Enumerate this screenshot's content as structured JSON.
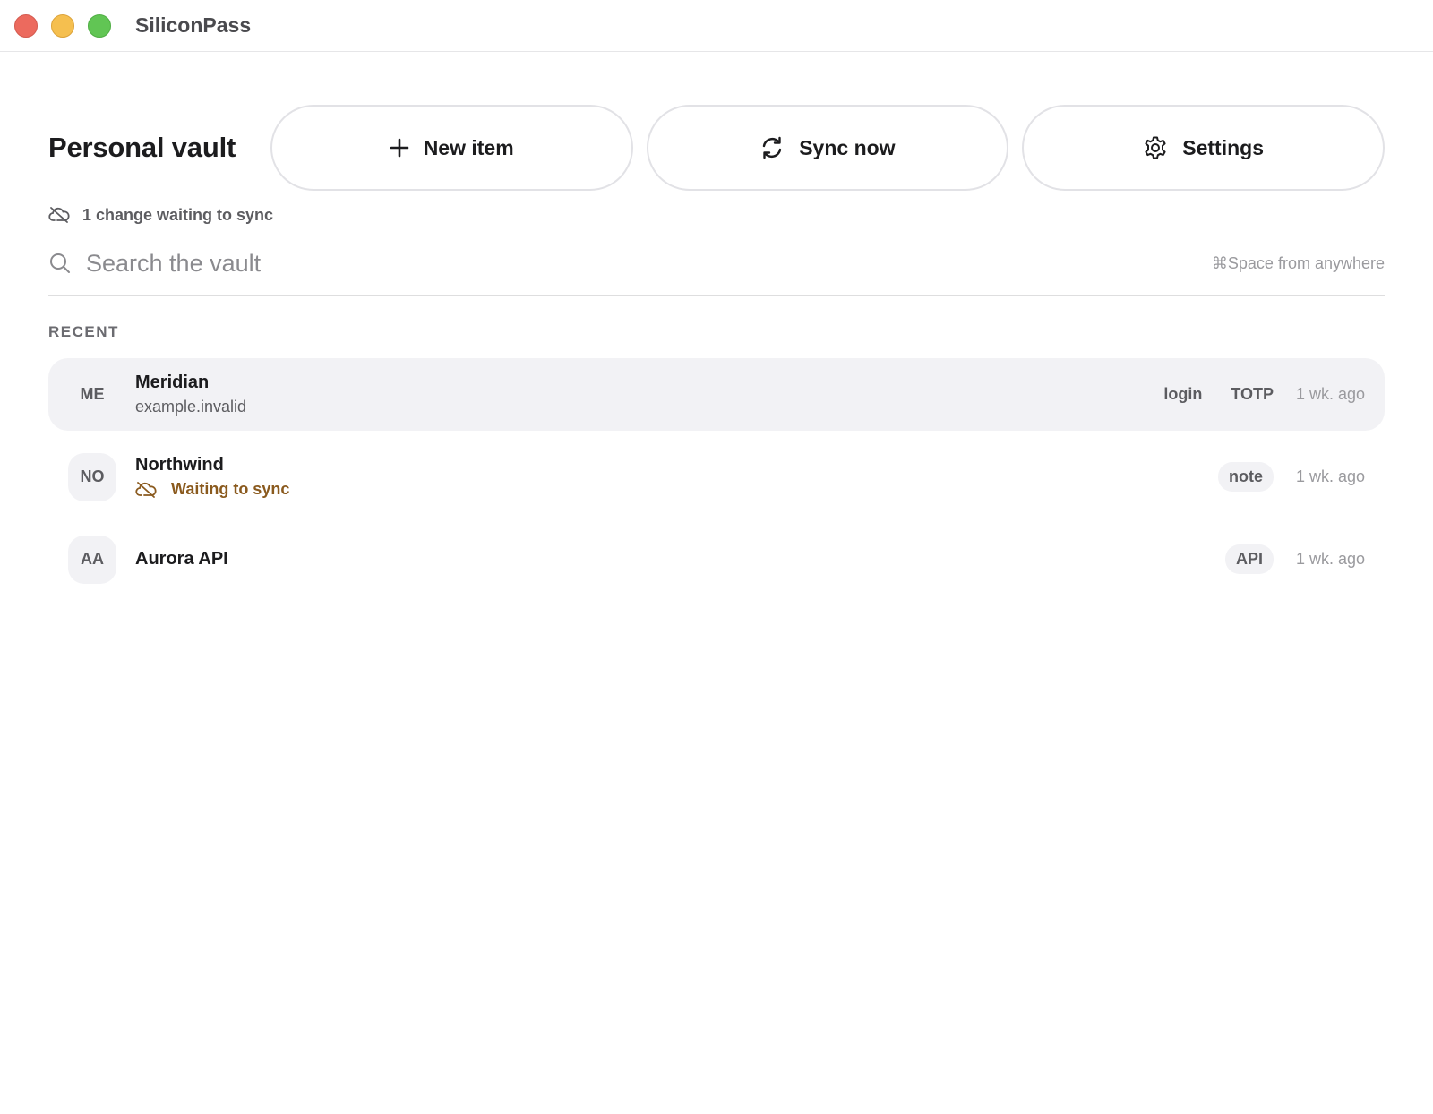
{
  "window": {
    "title": "SiliconPass",
    "controls": [
      "close",
      "minimize",
      "zoom"
    ]
  },
  "header": {
    "vault_title": "Personal vault",
    "buttons": {
      "new_item": {
        "label": "New item",
        "icon": "plus-icon"
      },
      "sync_now": {
        "label": "Sync now",
        "icon": "sync-icon"
      },
      "settings": {
        "label": "Settings",
        "icon": "gear-icon"
      }
    }
  },
  "sync_status": {
    "text": "1 change waiting to sync",
    "icon": "cloud-offline-icon"
  },
  "search": {
    "placeholder": "Search the vault",
    "value": "",
    "shortcut": "⌘Space from anywhere"
  },
  "recent": {
    "label": "RECENT",
    "items": [
      {
        "initials": "ME",
        "name": "Meridian",
        "subtitle": "example.invalid",
        "tags": [
          "login",
          "TOTP"
        ],
        "time": "1 wk. ago",
        "selected": true
      },
      {
        "initials": "NO",
        "name": "Northwind",
        "subtitle": "Waiting to sync",
        "tags": [
          "note"
        ],
        "time": "1 wk. ago",
        "selected": false
      },
      {
        "initials": "AA",
        "name": "Aurora API",
        "subtitle": "",
        "tags": [
          "API"
        ],
        "time": "1 wk. ago",
        "selected": false
      }
    ]
  },
  "colors": {
    "pending_text": "#8a5a1e",
    "selected_row_bg": "#f2f2f5",
    "close": "#ec6a5e",
    "minimize": "#f5bf4f",
    "zoom": "#61c554"
  }
}
